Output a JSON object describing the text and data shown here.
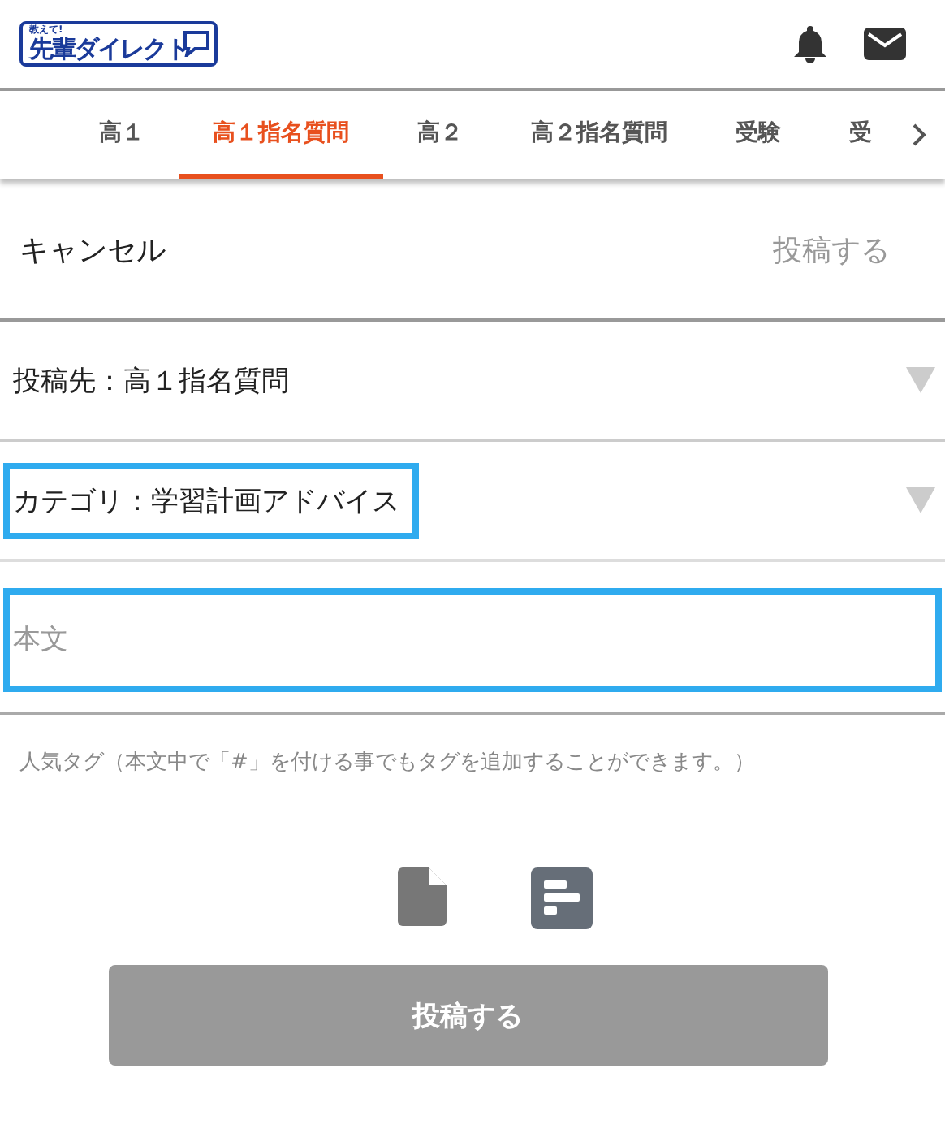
{
  "header": {
    "logo": {
      "tagline": "教えて!",
      "name": "先輩ダイレクト"
    }
  },
  "tabs": [
    {
      "label": "高１",
      "selected": false
    },
    {
      "label": "高１指名質問",
      "selected": true
    },
    {
      "label": "高２",
      "selected": false
    },
    {
      "label": "高２指名質問",
      "selected": false
    },
    {
      "label": "受験",
      "selected": false
    },
    {
      "label": "受",
      "selected": false
    }
  ],
  "action_bar": {
    "cancel": "キャンセル",
    "post": "投稿する",
    "post_disabled": true
  },
  "selects": [
    {
      "label": "投稿先：高１指名質問",
      "highlighted": false
    },
    {
      "label": "カテゴリ：学習計画アドバイス",
      "highlighted": true
    }
  ],
  "body_field": {
    "placeholder": "本文",
    "highlighted": true
  },
  "tag_hint": "人気タグ（本文中で「#」を付ける事でもタグを追加することができます。）",
  "submit_button": {
    "label": "投稿する",
    "disabled": true
  }
}
